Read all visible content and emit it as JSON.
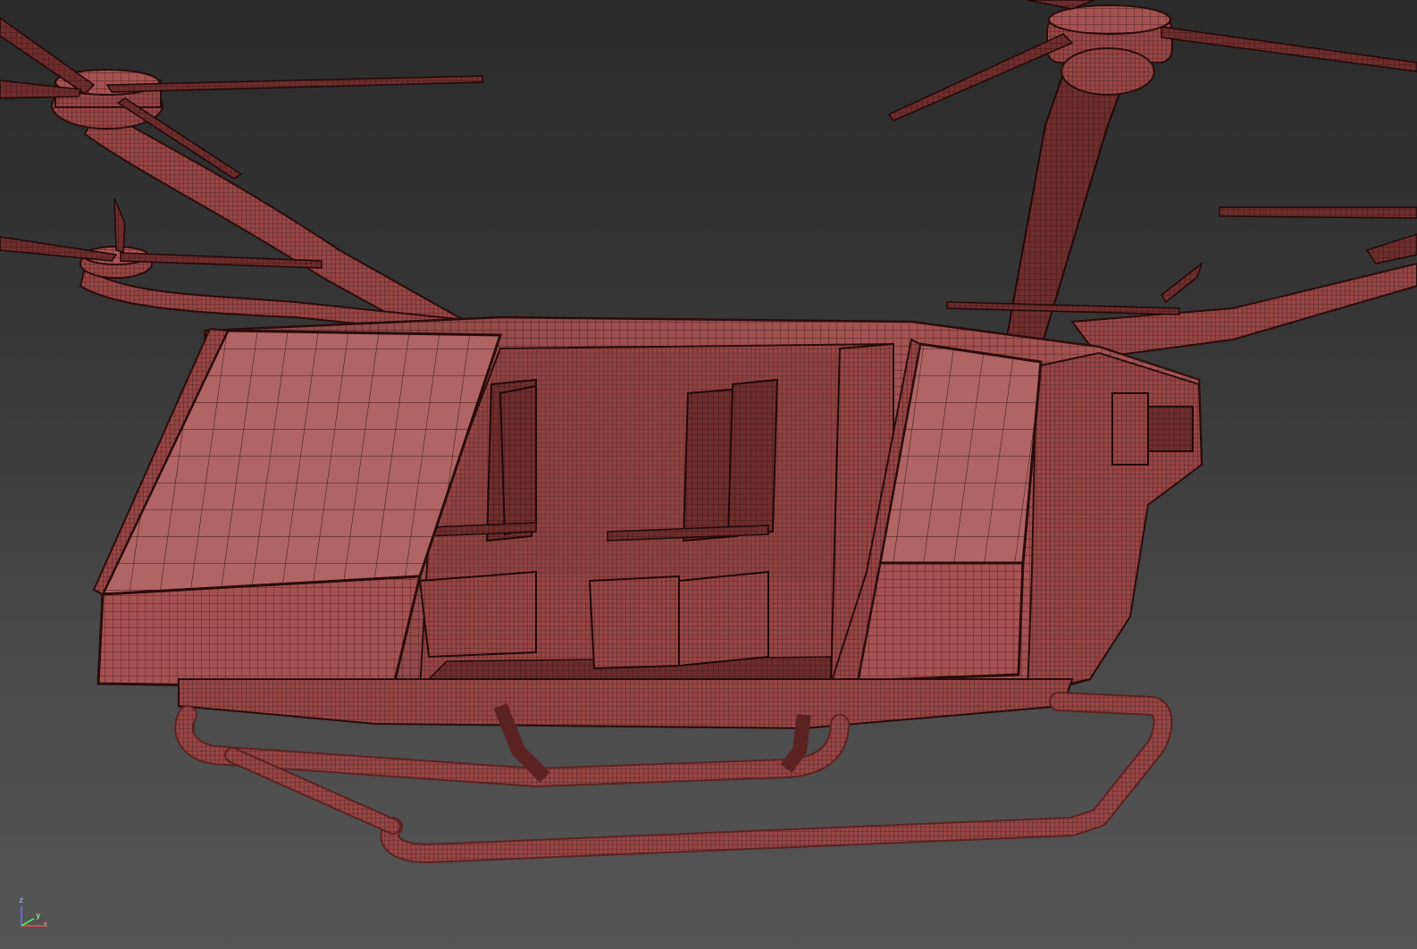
{
  "viewport": {
    "name": "perspective-viewport",
    "display_mode": "wireframe-on-shaded",
    "model": "passenger-drone-evtol"
  },
  "axis_gizmo": {
    "z_label": "z",
    "x_label": "x",
    "y_label": "y"
  },
  "colors": {
    "background_top": "#2b2b2b",
    "background_bottom": "#555555",
    "mesh_fill": "#9a4a4a",
    "mesh_fill_light": "#c07070",
    "wire": "#3a1515",
    "axis_z": "#6f6fff",
    "axis_x": "#ff4a4a",
    "axis_y": "#4aff4a"
  }
}
